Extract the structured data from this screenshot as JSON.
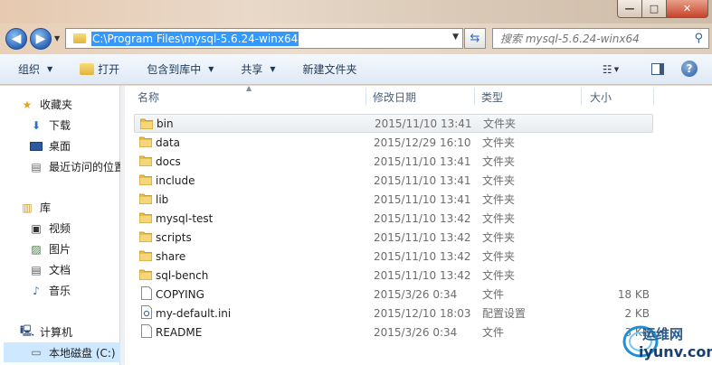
{
  "window": {
    "minimize_glyph": "—",
    "maximize_glyph": "□",
    "close_glyph": "✕"
  },
  "address": {
    "path": "C:\\Program Files\\mysql-5.6.24-winx64"
  },
  "search": {
    "placeholder": "搜索 mysql-5.6.24-winx64"
  },
  "toolbar": {
    "organize": "组织",
    "open": "打开",
    "include_in_library": "包含到库中",
    "share": "共享",
    "new_folder": "新建文件夹"
  },
  "nav": {
    "favorites": "收藏夹",
    "downloads": "下载",
    "desktop": "桌面",
    "recent": "最近访问的位置",
    "libraries": "库",
    "videos": "视频",
    "pictures": "图片",
    "documents": "文档",
    "music": "音乐",
    "computer": "计算机",
    "local_disk": "本地磁盘 (C:)"
  },
  "columns": {
    "name": "名称",
    "date": "修改日期",
    "type": "类型",
    "size": "大小"
  },
  "files": [
    {
      "name": "bin",
      "date": "2015/11/10 13:41",
      "type": "文件夹",
      "size": "",
      "kind": "folder"
    },
    {
      "name": "data",
      "date": "2015/12/29 16:10",
      "type": "文件夹",
      "size": "",
      "kind": "folder"
    },
    {
      "name": "docs",
      "date": "2015/11/10 13:41",
      "type": "文件夹",
      "size": "",
      "kind": "folder"
    },
    {
      "name": "include",
      "date": "2015/11/10 13:41",
      "type": "文件夹",
      "size": "",
      "kind": "folder"
    },
    {
      "name": "lib",
      "date": "2015/11/10 13:41",
      "type": "文件夹",
      "size": "",
      "kind": "folder"
    },
    {
      "name": "mysql-test",
      "date": "2015/11/10 13:42",
      "type": "文件夹",
      "size": "",
      "kind": "folder"
    },
    {
      "name": "scripts",
      "date": "2015/11/10 13:42",
      "type": "文件夹",
      "size": "",
      "kind": "folder"
    },
    {
      "name": "share",
      "date": "2015/11/10 13:42",
      "type": "文件夹",
      "size": "",
      "kind": "folder"
    },
    {
      "name": "sql-bench",
      "date": "2015/11/10 13:42",
      "type": "文件夹",
      "size": "",
      "kind": "folder"
    },
    {
      "name": "COPYING",
      "date": "2015/3/26 0:34",
      "type": "文件",
      "size": "18 KB",
      "kind": "file"
    },
    {
      "name": "my-default.ini",
      "date": "2015/12/10 18:03",
      "type": "配置设置",
      "size": "2 KB",
      "kind": "ini"
    },
    {
      "name": "README",
      "date": "2015/3/26 0:34",
      "type": "文件",
      "size": "3 KB",
      "kind": "file"
    }
  ],
  "watermark": {
    "line1": "运维网",
    "line2": "iyunv.com"
  },
  "colors": {
    "folder": "#e8bf4c",
    "selection": "#3399ff",
    "header_text": "#4c607a"
  }
}
